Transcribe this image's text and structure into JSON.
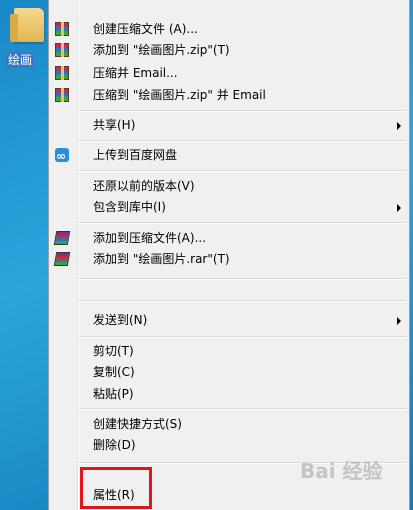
{
  "desktop": {
    "icon_label": "绘画"
  },
  "menu": {
    "items": [
      {
        "label": "创建压缩文件 (A)...",
        "icon": "winrar-icon"
      },
      {
        "label": "添加到 \"绘画图片.zip\"(T)",
        "icon": "winrar-icon"
      },
      {
        "label": "压缩并 Email...",
        "icon": "winrar-icon"
      },
      {
        "label": "压缩到 \"绘画图片.zip\" 并 Email",
        "icon": "winrar-icon"
      },
      {
        "label": "共享(H)"
      },
      {
        "label": "上传到百度网盘",
        "icon": "baidu-cloud-icon"
      },
      {
        "label": "还原以前的版本(V)"
      },
      {
        "label": "包含到库中(I)"
      },
      {
        "label": "添加到压缩文件(A)...",
        "icon": "rar-books-icon"
      },
      {
        "label": "添加到 \"绘画图片.rar\"(T)",
        "icon": "rar-books-icon"
      },
      {
        "label": "发送到(N)"
      },
      {
        "label": "剪切(T)"
      },
      {
        "label": "复制(C)"
      },
      {
        "label": "粘贴(P)"
      },
      {
        "label": "创建快捷方式(S)"
      },
      {
        "label": "删除(D)"
      },
      {
        "label": "属性(R)"
      }
    ]
  },
  "colors": {
    "highlight": "#e0151b",
    "desktop": "#1b88c8",
    "menu_bg": "#f0f0f0"
  },
  "watermark": "Bai 经验"
}
